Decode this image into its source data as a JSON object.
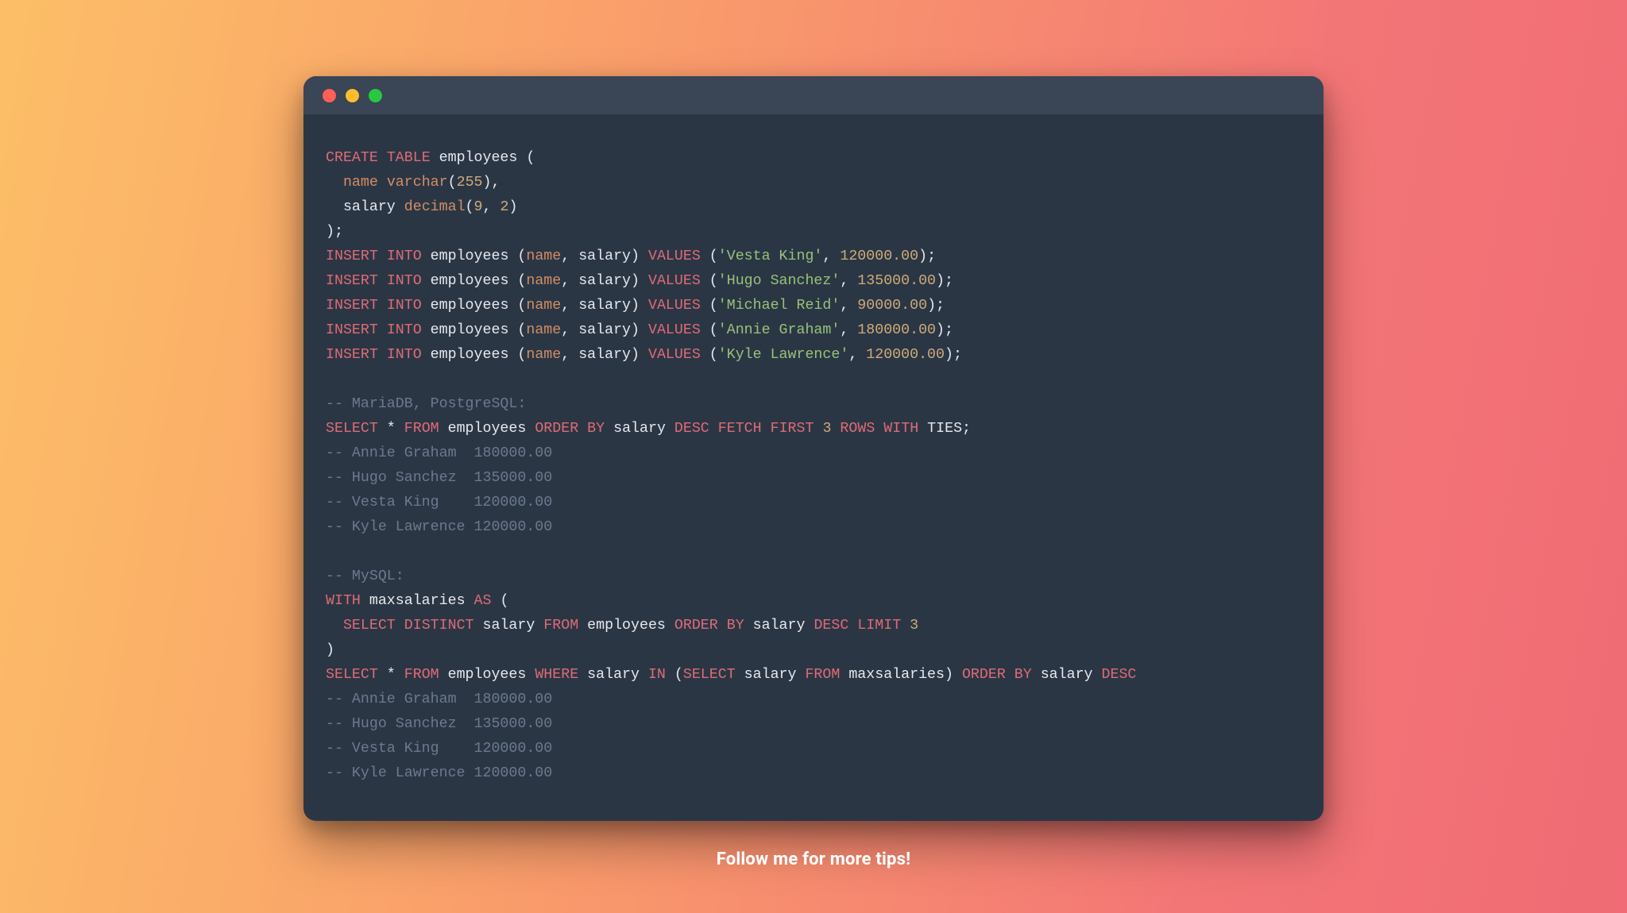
{
  "window": {
    "dots": [
      "red",
      "yellow",
      "green"
    ]
  },
  "code": {
    "lines": [
      [
        {
          "c": "tok-kw",
          "t": "CREATE"
        },
        {
          "c": "tok-op",
          "t": " "
        },
        {
          "c": "tok-kw",
          "t": "TABLE"
        },
        {
          "c": "tok-op",
          "t": " employees ("
        }
      ],
      [
        {
          "c": "tok-op",
          "t": "  "
        },
        {
          "c": "tok-col",
          "t": "name"
        },
        {
          "c": "tok-op",
          "t": " "
        },
        {
          "c": "tok-col",
          "t": "varchar"
        },
        {
          "c": "tok-op",
          "t": "("
        },
        {
          "c": "tok-num",
          "t": "255"
        },
        {
          "c": "tok-op",
          "t": "),"
        }
      ],
      [
        {
          "c": "tok-op",
          "t": "  salary "
        },
        {
          "c": "tok-col",
          "t": "decimal"
        },
        {
          "c": "tok-op",
          "t": "("
        },
        {
          "c": "tok-num",
          "t": "9"
        },
        {
          "c": "tok-op",
          "t": ", "
        },
        {
          "c": "tok-num",
          "t": "2"
        },
        {
          "c": "tok-op",
          "t": ")"
        }
      ],
      [
        {
          "c": "tok-op",
          "t": ");"
        }
      ],
      [
        {
          "c": "tok-kw",
          "t": "INSERT"
        },
        {
          "c": "tok-op",
          "t": " "
        },
        {
          "c": "tok-kw",
          "t": "INTO"
        },
        {
          "c": "tok-op",
          "t": " employees ("
        },
        {
          "c": "tok-col",
          "t": "name"
        },
        {
          "c": "tok-op",
          "t": ", salary) "
        },
        {
          "c": "tok-kw",
          "t": "VALUES"
        },
        {
          "c": "tok-op",
          "t": " ("
        },
        {
          "c": "tok-str",
          "t": "'Vesta King'"
        },
        {
          "c": "tok-op",
          "t": ", "
        },
        {
          "c": "tok-num",
          "t": "120000.00"
        },
        {
          "c": "tok-op",
          "t": ");"
        }
      ],
      [
        {
          "c": "tok-kw",
          "t": "INSERT"
        },
        {
          "c": "tok-op",
          "t": " "
        },
        {
          "c": "tok-kw",
          "t": "INTO"
        },
        {
          "c": "tok-op",
          "t": " employees ("
        },
        {
          "c": "tok-col",
          "t": "name"
        },
        {
          "c": "tok-op",
          "t": ", salary) "
        },
        {
          "c": "tok-kw",
          "t": "VALUES"
        },
        {
          "c": "tok-op",
          "t": " ("
        },
        {
          "c": "tok-str",
          "t": "'Hugo Sanchez'"
        },
        {
          "c": "tok-op",
          "t": ", "
        },
        {
          "c": "tok-num",
          "t": "135000.00"
        },
        {
          "c": "tok-op",
          "t": ");"
        }
      ],
      [
        {
          "c": "tok-kw",
          "t": "INSERT"
        },
        {
          "c": "tok-op",
          "t": " "
        },
        {
          "c": "tok-kw",
          "t": "INTO"
        },
        {
          "c": "tok-op",
          "t": " employees ("
        },
        {
          "c": "tok-col",
          "t": "name"
        },
        {
          "c": "tok-op",
          "t": ", salary) "
        },
        {
          "c": "tok-kw",
          "t": "VALUES"
        },
        {
          "c": "tok-op",
          "t": " ("
        },
        {
          "c": "tok-str",
          "t": "'Michael Reid'"
        },
        {
          "c": "tok-op",
          "t": ", "
        },
        {
          "c": "tok-num",
          "t": "90000.00"
        },
        {
          "c": "tok-op",
          "t": ");"
        }
      ],
      [
        {
          "c": "tok-kw",
          "t": "INSERT"
        },
        {
          "c": "tok-op",
          "t": " "
        },
        {
          "c": "tok-kw",
          "t": "INTO"
        },
        {
          "c": "tok-op",
          "t": " employees ("
        },
        {
          "c": "tok-col",
          "t": "name"
        },
        {
          "c": "tok-op",
          "t": ", salary) "
        },
        {
          "c": "tok-kw",
          "t": "VALUES"
        },
        {
          "c": "tok-op",
          "t": " ("
        },
        {
          "c": "tok-str",
          "t": "'Annie Graham'"
        },
        {
          "c": "tok-op",
          "t": ", "
        },
        {
          "c": "tok-num",
          "t": "180000.00"
        },
        {
          "c": "tok-op",
          "t": ");"
        }
      ],
      [
        {
          "c": "tok-kw",
          "t": "INSERT"
        },
        {
          "c": "tok-op",
          "t": " "
        },
        {
          "c": "tok-kw",
          "t": "INTO"
        },
        {
          "c": "tok-op",
          "t": " employees ("
        },
        {
          "c": "tok-col",
          "t": "name"
        },
        {
          "c": "tok-op",
          "t": ", salary) "
        },
        {
          "c": "tok-kw",
          "t": "VALUES"
        },
        {
          "c": "tok-op",
          "t": " ("
        },
        {
          "c": "tok-str",
          "t": "'Kyle Lawrence'"
        },
        {
          "c": "tok-op",
          "t": ", "
        },
        {
          "c": "tok-num",
          "t": "120000.00"
        },
        {
          "c": "tok-op",
          "t": ");"
        }
      ],
      [
        {
          "c": "tok-op",
          "t": ""
        }
      ],
      [
        {
          "c": "tok-cmt",
          "t": "-- MariaDB, PostgreSQL:"
        }
      ],
      [
        {
          "c": "tok-kw",
          "t": "SELECT"
        },
        {
          "c": "tok-op",
          "t": " * "
        },
        {
          "c": "tok-kw",
          "t": "FROM"
        },
        {
          "c": "tok-op",
          "t": " employees "
        },
        {
          "c": "tok-kw",
          "t": "ORDER"
        },
        {
          "c": "tok-op",
          "t": " "
        },
        {
          "c": "tok-kw",
          "t": "BY"
        },
        {
          "c": "tok-op",
          "t": " salary "
        },
        {
          "c": "tok-kw",
          "t": "DESC"
        },
        {
          "c": "tok-op",
          "t": " "
        },
        {
          "c": "tok-kw",
          "t": "FETCH"
        },
        {
          "c": "tok-op",
          "t": " "
        },
        {
          "c": "tok-kw",
          "t": "FIRST"
        },
        {
          "c": "tok-op",
          "t": " "
        },
        {
          "c": "tok-num",
          "t": "3"
        },
        {
          "c": "tok-op",
          "t": " "
        },
        {
          "c": "tok-kw",
          "t": "ROWS"
        },
        {
          "c": "tok-op",
          "t": " "
        },
        {
          "c": "tok-kw",
          "t": "WITH"
        },
        {
          "c": "tok-op",
          "t": " TIES;"
        }
      ],
      [
        {
          "c": "tok-cmt",
          "t": "-- Annie Graham  180000.00"
        }
      ],
      [
        {
          "c": "tok-cmt",
          "t": "-- Hugo Sanchez  135000.00"
        }
      ],
      [
        {
          "c": "tok-cmt",
          "t": "-- Vesta King    120000.00"
        }
      ],
      [
        {
          "c": "tok-cmt",
          "t": "-- Kyle Lawrence 120000.00"
        }
      ],
      [
        {
          "c": "tok-op",
          "t": ""
        }
      ],
      [
        {
          "c": "tok-cmt",
          "t": "-- MySQL:"
        }
      ],
      [
        {
          "c": "tok-kw",
          "t": "WITH"
        },
        {
          "c": "tok-op",
          "t": " maxsalaries "
        },
        {
          "c": "tok-kw",
          "t": "AS"
        },
        {
          "c": "tok-op",
          "t": " ("
        }
      ],
      [
        {
          "c": "tok-op",
          "t": "  "
        },
        {
          "c": "tok-kw",
          "t": "SELECT"
        },
        {
          "c": "tok-op",
          "t": " "
        },
        {
          "c": "tok-kw",
          "t": "DISTINCT"
        },
        {
          "c": "tok-op",
          "t": " salary "
        },
        {
          "c": "tok-kw",
          "t": "FROM"
        },
        {
          "c": "tok-op",
          "t": " employees "
        },
        {
          "c": "tok-kw",
          "t": "ORDER"
        },
        {
          "c": "tok-op",
          "t": " "
        },
        {
          "c": "tok-kw",
          "t": "BY"
        },
        {
          "c": "tok-op",
          "t": " salary "
        },
        {
          "c": "tok-kw",
          "t": "DESC"
        },
        {
          "c": "tok-op",
          "t": " "
        },
        {
          "c": "tok-kw",
          "t": "LIMIT"
        },
        {
          "c": "tok-op",
          "t": " "
        },
        {
          "c": "tok-num",
          "t": "3"
        }
      ],
      [
        {
          "c": "tok-op",
          "t": ")"
        }
      ],
      [
        {
          "c": "tok-kw",
          "t": "SELECT"
        },
        {
          "c": "tok-op",
          "t": " * "
        },
        {
          "c": "tok-kw",
          "t": "FROM"
        },
        {
          "c": "tok-op",
          "t": " employees "
        },
        {
          "c": "tok-kw",
          "t": "WHERE"
        },
        {
          "c": "tok-op",
          "t": " salary "
        },
        {
          "c": "tok-kw",
          "t": "IN"
        },
        {
          "c": "tok-op",
          "t": " ("
        },
        {
          "c": "tok-kw",
          "t": "SELECT"
        },
        {
          "c": "tok-op",
          "t": " salary "
        },
        {
          "c": "tok-kw",
          "t": "FROM"
        },
        {
          "c": "tok-op",
          "t": " maxsalaries) "
        },
        {
          "c": "tok-kw",
          "t": "ORDER"
        },
        {
          "c": "tok-op",
          "t": " "
        },
        {
          "c": "tok-kw",
          "t": "BY"
        },
        {
          "c": "tok-op",
          "t": " salary "
        },
        {
          "c": "tok-kw",
          "t": "DESC"
        }
      ],
      [
        {
          "c": "tok-cmt",
          "t": "-- Annie Graham  180000.00"
        }
      ],
      [
        {
          "c": "tok-cmt",
          "t": "-- Hugo Sanchez  135000.00"
        }
      ],
      [
        {
          "c": "tok-cmt",
          "t": "-- Vesta King    120000.00"
        }
      ],
      [
        {
          "c": "tok-cmt",
          "t": "-- Kyle Lawrence 120000.00"
        }
      ]
    ]
  },
  "caption": "Follow me for more tips!"
}
